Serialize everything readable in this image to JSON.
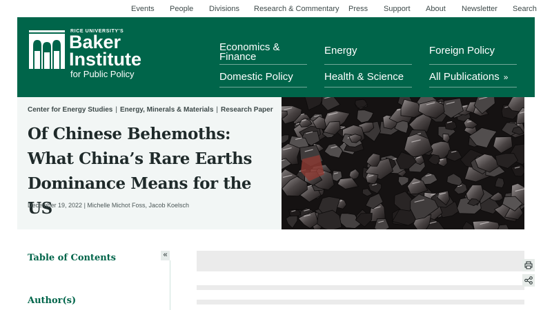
{
  "utility_nav": [
    "Events",
    "People",
    "Divisions",
    "Research & Commentary",
    "Press",
    "Support",
    "About",
    "Newsletter",
    "Search"
  ],
  "logo": {
    "line1": "RICE UNIVERSITY'S",
    "line2": "Baker",
    "line3": "Institute",
    "line4": "for Public Policy"
  },
  "main_nav": {
    "economics": "Economics & Finance",
    "energy": "Energy",
    "foreign": "Foreign Policy",
    "domestic": "Domestic Policy",
    "health": "Health & Science",
    "publications": "All Publications",
    "publications_arrow": "»"
  },
  "hero": {
    "breadcrumbs": [
      "Center for Energy Studies",
      "Energy, Minerals & Materials",
      "Research Paper"
    ],
    "title": "Of Chinese Behemoths: What China’s Rare Earths Dominance Means for the US",
    "date": "December 19, 2022",
    "authors": [
      "Michelle Michot Foss",
      "Jacob Koelsch"
    ]
  },
  "sidebar": {
    "toc_title": "Table of Contents",
    "collapse_label": "«",
    "authors_title": "Author(s)"
  },
  "icons": {
    "print": "printer-icon",
    "share": "share-icon"
  },
  "colors": {
    "brand_green": "#00654a",
    "hero_bg": "#f2f6f5",
    "text": "#1f2a2a"
  }
}
